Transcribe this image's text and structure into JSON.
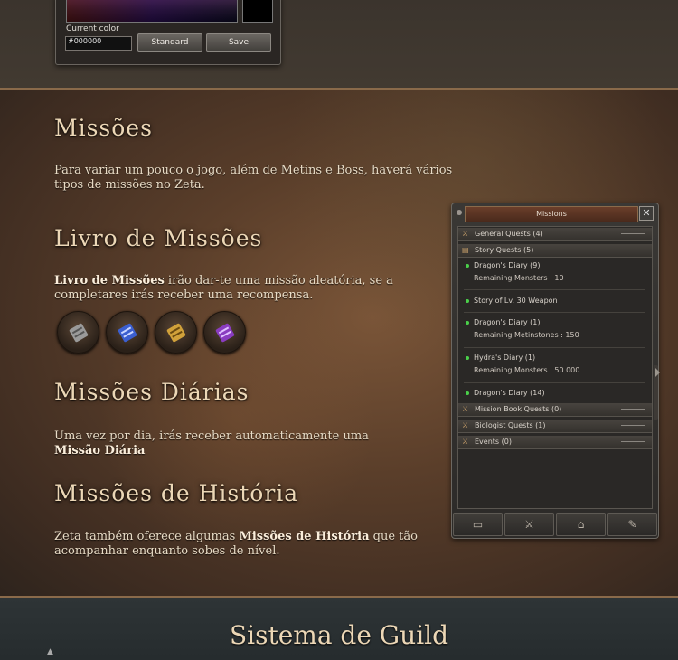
{
  "color_picker": {
    "current_color_label": "Current color",
    "hex_value": "#000000",
    "standard_label": "Standard",
    "save_label": "Save"
  },
  "sections": {
    "missoes": {
      "title": "Missões",
      "text": "Para variar um pouco o jogo, além de Metins e Boss, haverá vários tipos de missões no Zeta."
    },
    "livro": {
      "title": "Livro de Missões",
      "bold": "Livro de Missões",
      "text": " irão dar-te uma missão aleatória, se a completares irás receber uma recompensa."
    },
    "diarias": {
      "title": "Missões Diárias",
      "text": "Uma vez por dia, irás receber automaticamente uma ",
      "bold": "Missão Diária"
    },
    "historia": {
      "title": "Missões de História",
      "text_before": "Zeta também oferece algumas ",
      "bold": "Missões de História",
      "text_after": " que tão acompanhar enquanto sobes de nível."
    },
    "guild": {
      "title": "Sistema de Guild"
    }
  },
  "book_icons": [
    "gray-scroll-icon",
    "blue-scroll-icon",
    "gold-scroll-icon",
    "purple-scroll-icon"
  ],
  "missions_window": {
    "title": "Missions",
    "close": "✕",
    "categories": [
      "General Quests (4)",
      "Story Quests (5)",
      "Mission Book Quests (0)",
      "Biologist Quests (1)",
      "Events (0)"
    ],
    "quests": [
      {
        "name": "Dragon's Diary (9)",
        "detail": "Remaining Monsters : 10"
      },
      {
        "name": "Story of Lv. 30 Weapon",
        "detail": ""
      },
      {
        "name": "Dragon's Diary (1)",
        "detail": "Remaining Metinstones : 150"
      },
      {
        "name": "Hydra's Diary (1)",
        "detail": "Remaining Monsters : 50.000"
      },
      {
        "name": "Dragon's Diary (14)",
        "detail": ""
      }
    ],
    "tabs": [
      "character-tab-icon",
      "skills-tab-icon",
      "emotes-tab-icon",
      "quests-tab-icon"
    ]
  },
  "colors": {
    "heading": "#ecd7b6",
    "body_text": "#e9dcc6",
    "active_dot": "#4ad04a"
  }
}
